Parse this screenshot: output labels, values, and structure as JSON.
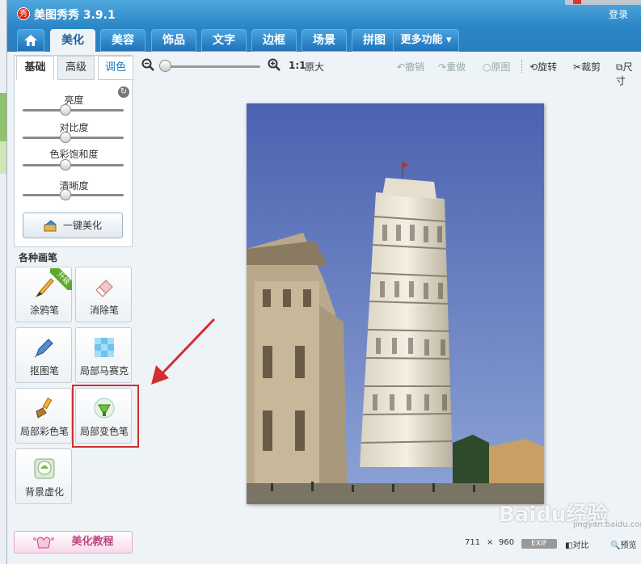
{
  "app": {
    "title": "美图秀秀 3.9.1",
    "logo_char": "秀",
    "login": "登录"
  },
  "tabs": {
    "home_icon": "home-icon",
    "items": [
      "美化",
      "美容",
      "饰品",
      "文字",
      "边框",
      "场景",
      "拼图"
    ],
    "more": "更多功能 ▾",
    "active": "美化"
  },
  "toolbar": {
    "ratio": "1:1",
    "original_size": "原大",
    "undo": "撤销",
    "redo": "重做",
    "original": "原图",
    "rotate": "旋转",
    "crop": "裁剪",
    "resize": "尺寸"
  },
  "adjust_panel": {
    "tabs": [
      "基础",
      "高级",
      "调色"
    ],
    "sliders": [
      {
        "label": "亮度",
        "level": 0.5
      },
      {
        "label": "对比度",
        "level": 0.5
      },
      {
        "label": "色彩饱和度",
        "level": 0.5
      },
      {
        "label": "清晰度",
        "level": 0.5
      }
    ],
    "one_key": "一键美化"
  },
  "brushes": {
    "title": "各种画笔",
    "upgrade_badge": "升级",
    "items": [
      "涂鸦笔",
      "消除笔",
      "抠图笔",
      "局部马赛克",
      "局部彩色笔",
      "局部变色笔",
      "背景虚化"
    ]
  },
  "tutorial": "美化教程",
  "status": {
    "width": "711",
    "x": "×",
    "height": "960",
    "exif": "EXIF",
    "compare": "对比",
    "preview": "预览"
  },
  "watermark": {
    "text": "Baidu经验",
    "sub": "jingyan.baidu.com"
  },
  "colors": {
    "title_blue": "#2b86c7",
    "highlight_red": "#d12f2f",
    "upgrade_green": "#5aa82d"
  }
}
